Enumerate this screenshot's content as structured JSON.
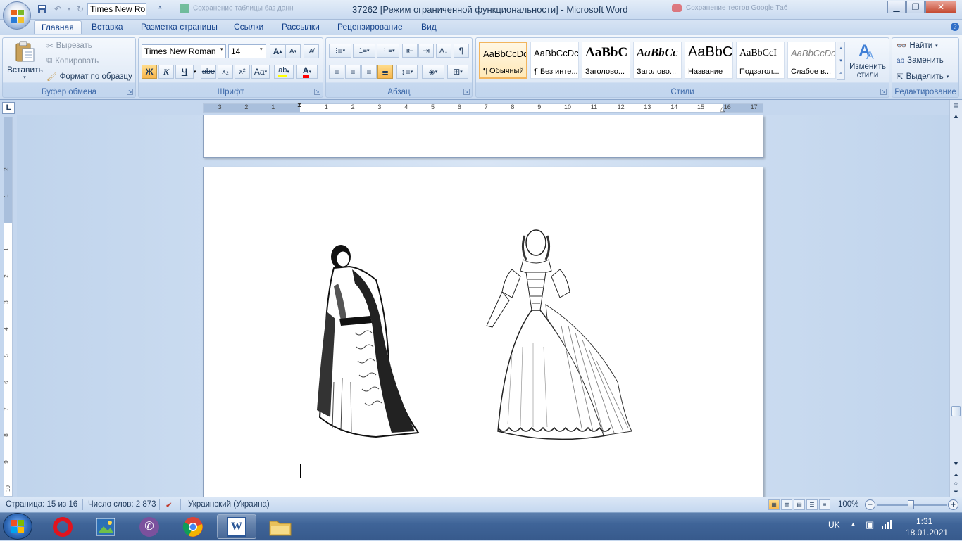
{
  "titlebar": {
    "title": "37262 [Режим ограниченной функциональности] - Microsoft Word",
    "qat_font": "Times New Ro",
    "bg_tab_1": "Сохранение таблицы баз данн",
    "bg_tab_2": "Сохранение тестов Google Таб"
  },
  "tabs": [
    "Главная",
    "Вставка",
    "Разметка страницы",
    "Ссылки",
    "Рассылки",
    "Рецензирование",
    "Вид"
  ],
  "clipboard": {
    "paste": "Вставить",
    "cut": "Вырезать",
    "copy": "Копировать",
    "format_painter": "Формат по образцу",
    "label": "Буфер обмена"
  },
  "font": {
    "name": "Times New Roman",
    "size": "14",
    "label": "Шрифт",
    "bold": "Ж",
    "italic": "К",
    "underline": "Ч",
    "strike": "abe",
    "sub": "x₂",
    "sup": "x²",
    "case": "Aa",
    "grow": "A",
    "shrink": "A"
  },
  "paragraph": {
    "label": "Абзац"
  },
  "styles": {
    "label": "Стили",
    "change": "Изменить стили",
    "items": [
      {
        "sample": "AaBbCcDc",
        "name": "¶ Обычный"
      },
      {
        "sample": "AaBbCcDc",
        "name": "¶ Без инте..."
      },
      {
        "sample": "AaBbC",
        "name": "Заголово..."
      },
      {
        "sample": "AaBbCc",
        "name": "Заголово..."
      },
      {
        "sample": "AaBbC",
        "name": "Название"
      },
      {
        "sample": "AaBbCcI",
        "name": "Подзагол..."
      },
      {
        "sample": "AaBbCcDc",
        "name": "Слабое в..."
      }
    ]
  },
  "editing": {
    "find": "Найти",
    "replace": "Заменить",
    "select": "Выделить",
    "label": "Редактирование"
  },
  "ruler": {
    "h_numbers": [
      "3",
      "2",
      "1",
      "1",
      "2",
      "3",
      "4",
      "5",
      "6",
      "7",
      "8",
      "9",
      "10",
      "11",
      "12",
      "13",
      "14",
      "15",
      "16",
      "17"
    ],
    "v_numbers": [
      "2",
      "1",
      "1",
      "2",
      "3",
      "4",
      "5",
      "6",
      "7",
      "8",
      "9",
      "10"
    ]
  },
  "status": {
    "page": "Страница: 15 из 16",
    "words": "Число слов: 2 873",
    "language": "Украинский (Украина)",
    "zoom": "100%"
  },
  "taskbar": {
    "lang": "UK",
    "time": "1:31",
    "date": "18.01.2021"
  },
  "colors": {
    "accent": "#15428b",
    "highlight": "#ffff00",
    "font_color": "#ff0000"
  }
}
